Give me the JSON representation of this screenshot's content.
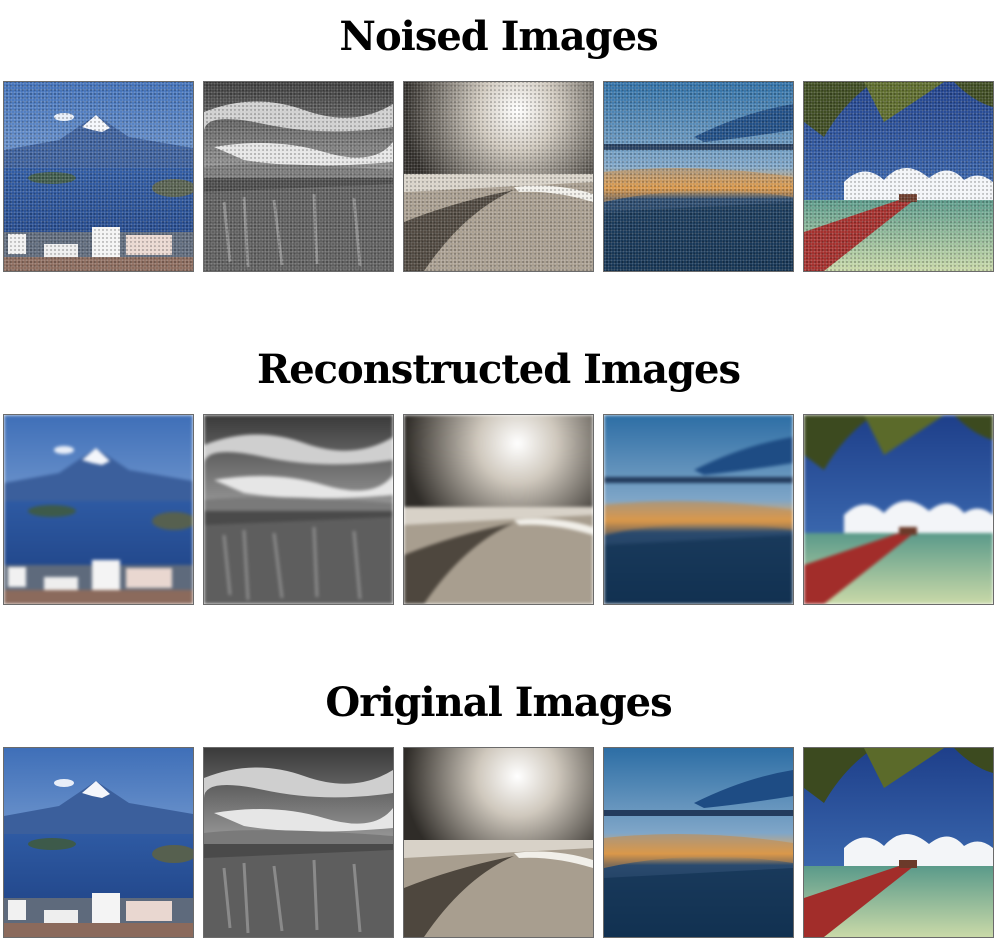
{
  "sections": [
    {
      "title": "Noised Images",
      "variant": "noisy"
    },
    {
      "title": "Reconstructed Images",
      "variant": "blurred"
    },
    {
      "title": "Original Images",
      "variant": "original"
    }
  ],
  "image_subjects": [
    "mountain-bay-landscape",
    "storm-clouds-field-bw",
    "sunlit-beach-sepia",
    "sunset-beach-reflection",
    "palm-pier-tropical-sea"
  ],
  "colors": {
    "background": "#ffffff",
    "title": "#000000",
    "tile_border": "#6b6b6b"
  }
}
